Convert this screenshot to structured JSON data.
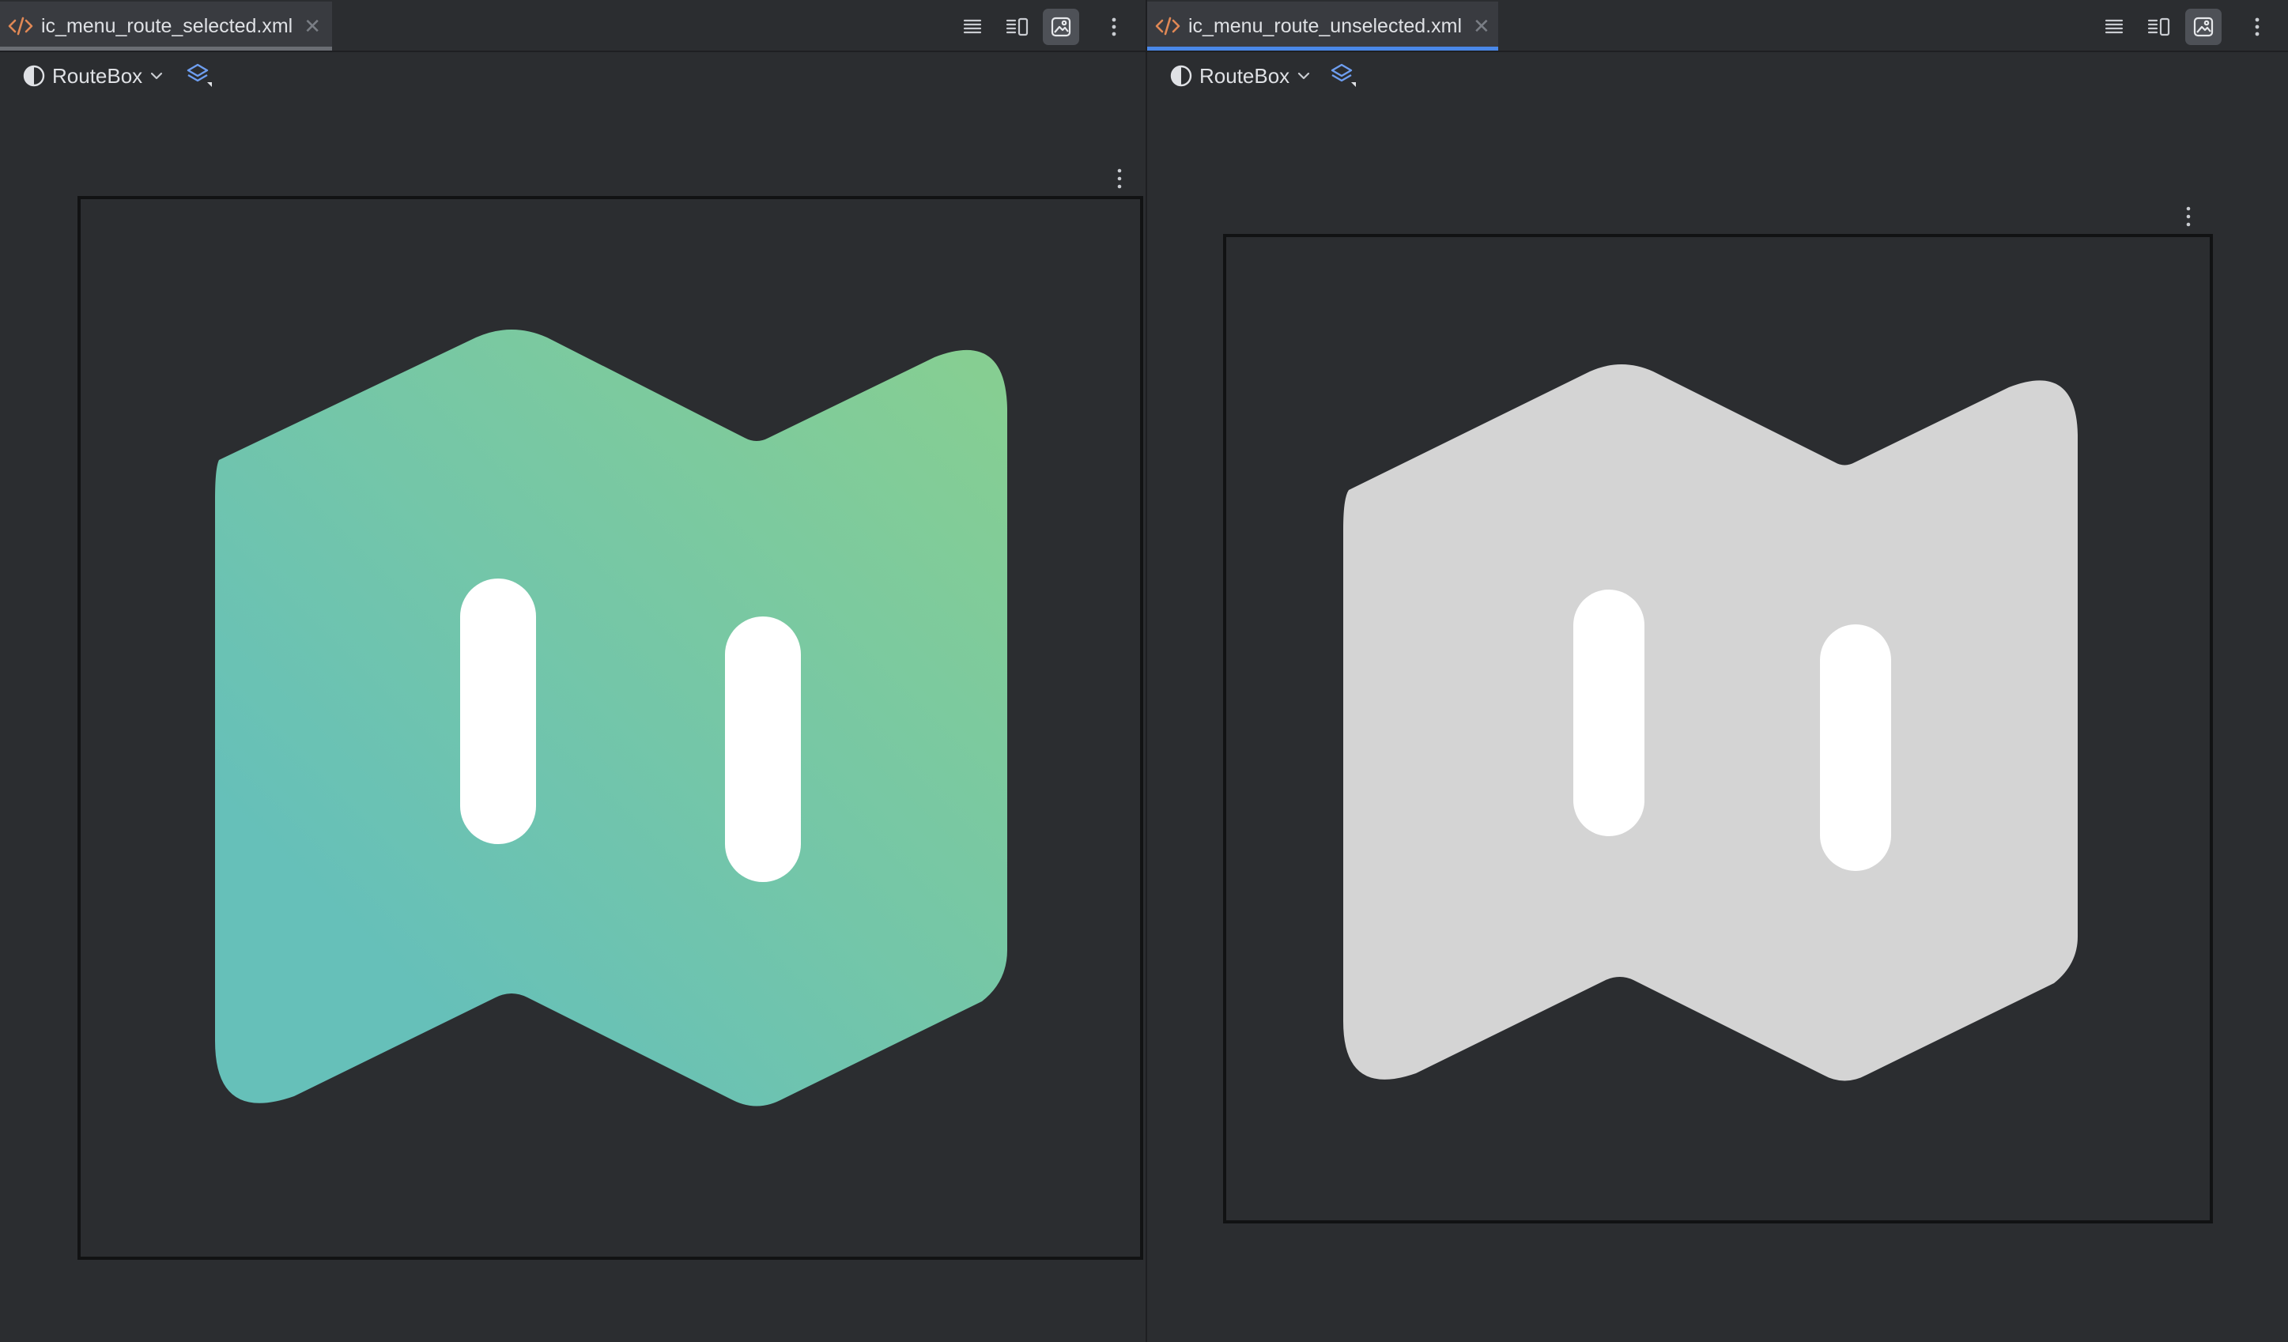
{
  "panes": [
    {
      "tab": {
        "file_name": "ic_menu_route_selected.xml",
        "icon": "xml-file-icon",
        "active": false
      },
      "toolbar": {
        "theme_label": "RouteBox",
        "theme_icon": "half-circle-theme-icon",
        "theme_chevron": "chevron-down-icon",
        "layers_icon": "layers-icon",
        "right_buttons": [
          "code-view-icon",
          "split-view-icon",
          "design-view-icon",
          "more-vertical-icon"
        ],
        "active_button": "design-view-icon"
      },
      "preview": {
        "fill": "gradient",
        "gradient_colors": [
          "#66c0b9",
          "#88cf90"
        ],
        "bar_color": "#ffffff"
      }
    },
    {
      "tab": {
        "file_name": "ic_menu_route_unselected.xml",
        "icon": "xml-file-icon",
        "active": true
      },
      "toolbar": {
        "theme_label": "RouteBox",
        "theme_icon": "half-circle-theme-icon",
        "theme_chevron": "chevron-down-icon",
        "layers_icon": "layers-icon",
        "right_buttons": [
          "code-view-icon",
          "split-view-icon",
          "design-view-icon",
          "more-vertical-icon"
        ],
        "active_button": "design-view-icon"
      },
      "preview": {
        "fill": "solid",
        "fill_color": "#d4d4d4",
        "bar_color": "#ffffff"
      }
    }
  ],
  "colors": {
    "background": "#2b2d30",
    "tab_active_underline": "#4a88e8",
    "tab_inactive_underline": "#6a6d73",
    "xml_icon": "#e08855",
    "layers_icon": "#6e9ef0"
  }
}
